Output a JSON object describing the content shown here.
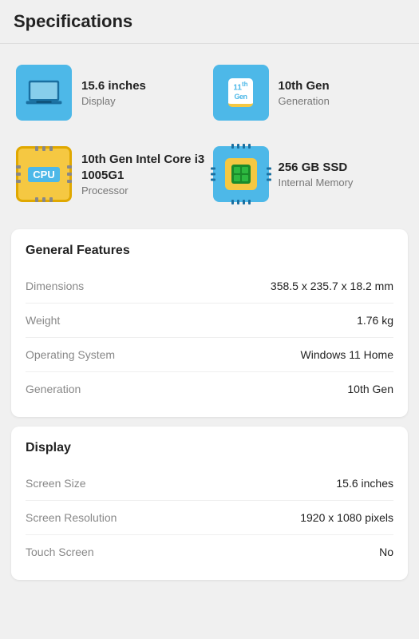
{
  "header": {
    "title": "Specifications"
  },
  "icons": [
    {
      "id": "display",
      "type": "laptop",
      "value": "15.6 inches",
      "label": "Display"
    },
    {
      "id": "generation",
      "type": "gen",
      "value": "10th Gen",
      "label": "Generation"
    },
    {
      "id": "processor",
      "type": "cpu",
      "value": "10th Gen Intel Core i3 1005G1",
      "label": "Processor"
    },
    {
      "id": "memory",
      "type": "chip",
      "value": "256 GB SSD",
      "label": "Internal Memory"
    }
  ],
  "sections": [
    {
      "id": "general",
      "title": "General Features",
      "rows": [
        {
          "label": "Dimensions",
          "value": "358.5 x 235.7 x 18.2 mm"
        },
        {
          "label": "Weight",
          "value": "1.76 kg"
        },
        {
          "label": "Operating System",
          "value": "Windows 11 Home"
        },
        {
          "label": "Generation",
          "value": "10th Gen"
        }
      ]
    },
    {
      "id": "display",
      "title": "Display",
      "rows": [
        {
          "label": "Screen Size",
          "value": "15.6 inches"
        },
        {
          "label": "Screen Resolution",
          "value": "1920 x 1080 pixels"
        },
        {
          "label": "Touch Screen",
          "value": "No"
        }
      ]
    }
  ]
}
